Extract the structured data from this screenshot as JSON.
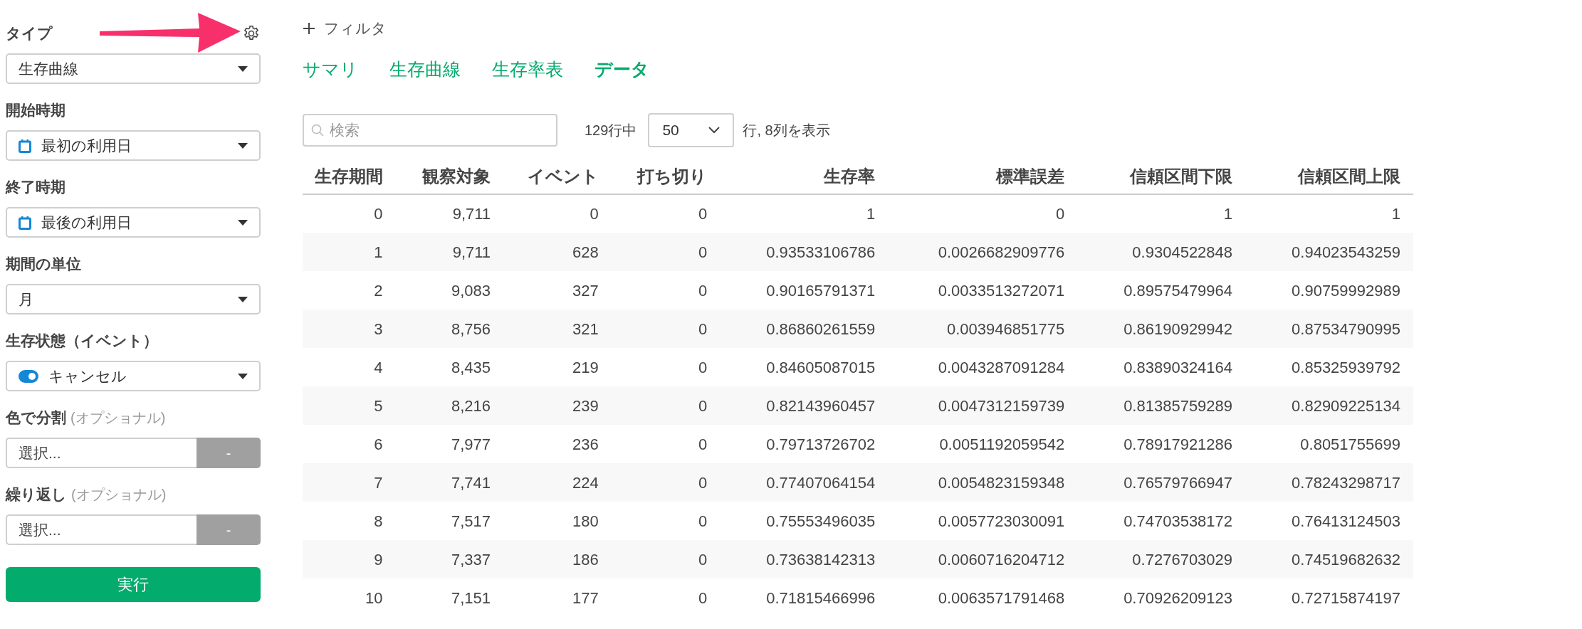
{
  "sidebar": {
    "fields": [
      {
        "kind": "select",
        "label": "タイプ",
        "value": "生存曲線"
      },
      {
        "kind": "date_select",
        "label": "開始時期",
        "value": "最初の利用日"
      },
      {
        "kind": "date_select",
        "label": "終了時期",
        "value": "最後の利用日"
      },
      {
        "kind": "select",
        "label": "期間の単位",
        "value": "月"
      },
      {
        "kind": "status_select",
        "label": "生存状態（イベント）",
        "value": "キャンセル",
        "on": true
      },
      {
        "kind": "picker",
        "label": "色で分割",
        "note": "(オプショナル)",
        "placeholder": "選択...",
        "button": "-"
      },
      {
        "kind": "picker",
        "label": "繰り返し",
        "note": "(オプショナル)",
        "placeholder": "選択...",
        "button": "-"
      }
    ],
    "run_button": "実行"
  },
  "main": {
    "filter_button": "フィルタ",
    "tabs": [
      {
        "label": "サマリ",
        "selected": false
      },
      {
        "label": "生存曲線",
        "selected": false
      },
      {
        "label": "生存率表",
        "selected": false
      },
      {
        "label": "データ",
        "selected": true
      }
    ],
    "search": {
      "placeholder": "検索"
    },
    "row_count": "129行中",
    "page_size": "50",
    "shown_text": "行, 8列を表示",
    "table": {
      "columns": [
        "生存期間",
        "観察対象",
        "イベント",
        "打ち切り",
        "生存率",
        "標準誤差",
        "信頼区間下限",
        "信頼区間上限"
      ],
      "rows": [
        [
          "0",
          "9,711",
          "0",
          "0",
          "1",
          "0",
          "1",
          "1"
        ],
        [
          "1",
          "9,711",
          "628",
          "0",
          "0.93533106786",
          "0.0026682909776",
          "0.9304522848",
          "0.94023543259"
        ],
        [
          "2",
          "9,083",
          "327",
          "0",
          "0.90165791371",
          "0.0033513272071",
          "0.89575479964",
          "0.90759992989"
        ],
        [
          "3",
          "8,756",
          "321",
          "0",
          "0.86860261559",
          "0.003946851775",
          "0.86190929942",
          "0.87534790995"
        ],
        [
          "4",
          "8,435",
          "219",
          "0",
          "0.84605087015",
          "0.0043287091284",
          "0.83890324164",
          "0.85325939792"
        ],
        [
          "5",
          "8,216",
          "239",
          "0",
          "0.82143960457",
          "0.0047312159739",
          "0.81385759289",
          "0.82909225134"
        ],
        [
          "6",
          "7,977",
          "236",
          "0",
          "0.79713726702",
          "0.0051192059542",
          "0.78917921286",
          "0.8051755699"
        ],
        [
          "7",
          "7,741",
          "224",
          "0",
          "0.77407064154",
          "0.0054823159348",
          "0.76579766947",
          "0.78243298717"
        ],
        [
          "8",
          "7,517",
          "180",
          "0",
          "0.75553496035",
          "0.0057723030091",
          "0.74703538172",
          "0.76413124503"
        ],
        [
          "9",
          "7,337",
          "186",
          "0",
          "0.73638142313",
          "0.0060716204712",
          "0.7276703029",
          "0.74519682632"
        ],
        [
          "10",
          "7,151",
          "177",
          "0",
          "0.71815466996",
          "0.0063571791468",
          "0.70926209123",
          "0.72715874197"
        ]
      ]
    }
  }
}
